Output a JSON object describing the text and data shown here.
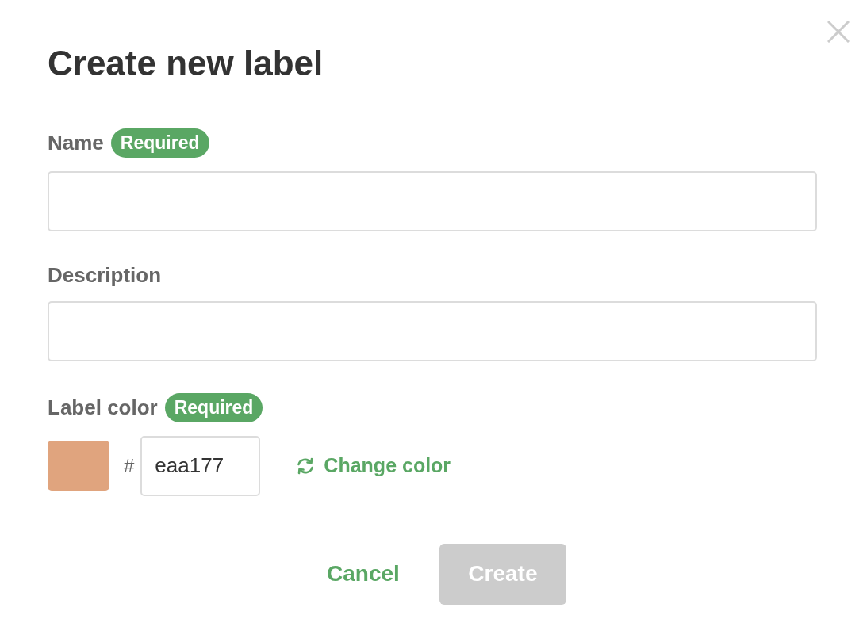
{
  "dialog": {
    "title": "Create new label"
  },
  "fields": [
    {
      "kind": "text",
      "label": "Name",
      "badge": "Required"
    },
    {
      "kind": "text",
      "label": "Description"
    },
    {
      "kind": "color",
      "label": "Label color",
      "badge": "Required",
      "color": "#e0a47e",
      "prefix": "#",
      "value": "eaa177",
      "action": "Change color"
    }
  ],
  "buttons": [
    {
      "kind": "link",
      "label": "Cancel",
      "disabled": false
    },
    {
      "kind": "primary",
      "label": "Create",
      "disabled": true
    }
  ]
}
